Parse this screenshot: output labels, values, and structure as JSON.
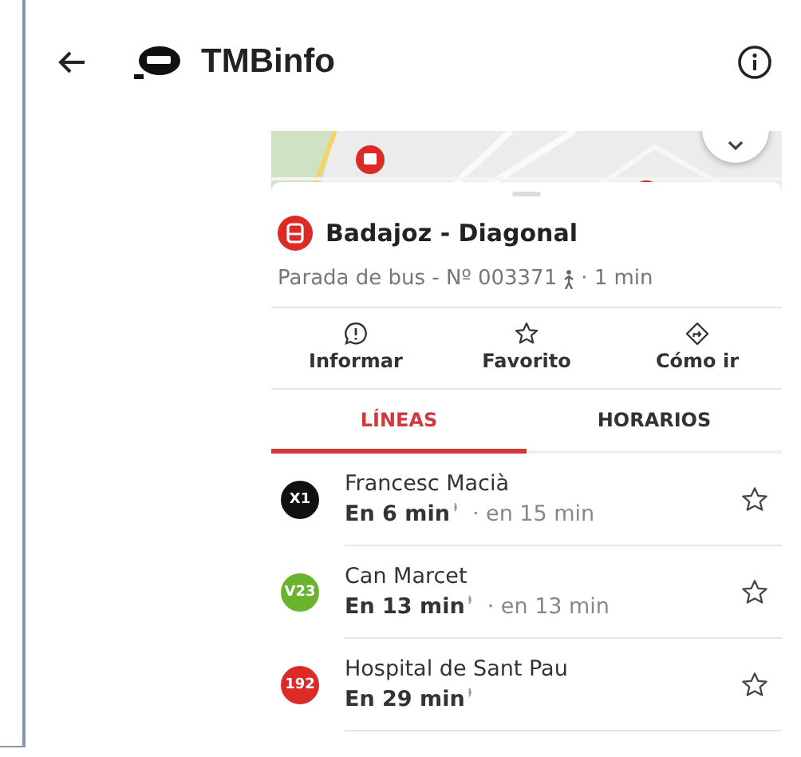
{
  "header": {
    "title": "TMBinfo"
  },
  "stop": {
    "name": "Badajoz - Diagonal",
    "subtitle": "Parada de bus - Nº 003371",
    "walk_time": "· 1 min"
  },
  "actions": [
    {
      "kind": "report",
      "label": "Informar"
    },
    {
      "kind": "favorite",
      "label": "Favorito"
    },
    {
      "kind": "directions",
      "label": "Cómo ir"
    }
  ],
  "tabs": [
    {
      "label": "LÍNEAS",
      "selected": true
    },
    {
      "label": "HORARIOS",
      "selected": false
    }
  ],
  "lines": [
    {
      "code": "X1",
      "color": "#111111",
      "destination": "Francesc Macià",
      "next": "En 6 min",
      "following": "· en 15 min"
    },
    {
      "code": "V23",
      "color": "#6ab42d",
      "destination": "Can Marcet",
      "next": "En 13 min",
      "following": "· en 13 min"
    },
    {
      "code": "192",
      "color": "#dc2b27",
      "destination": "Hospital de Sant Pau",
      "next": "En 29 min"
    }
  ]
}
